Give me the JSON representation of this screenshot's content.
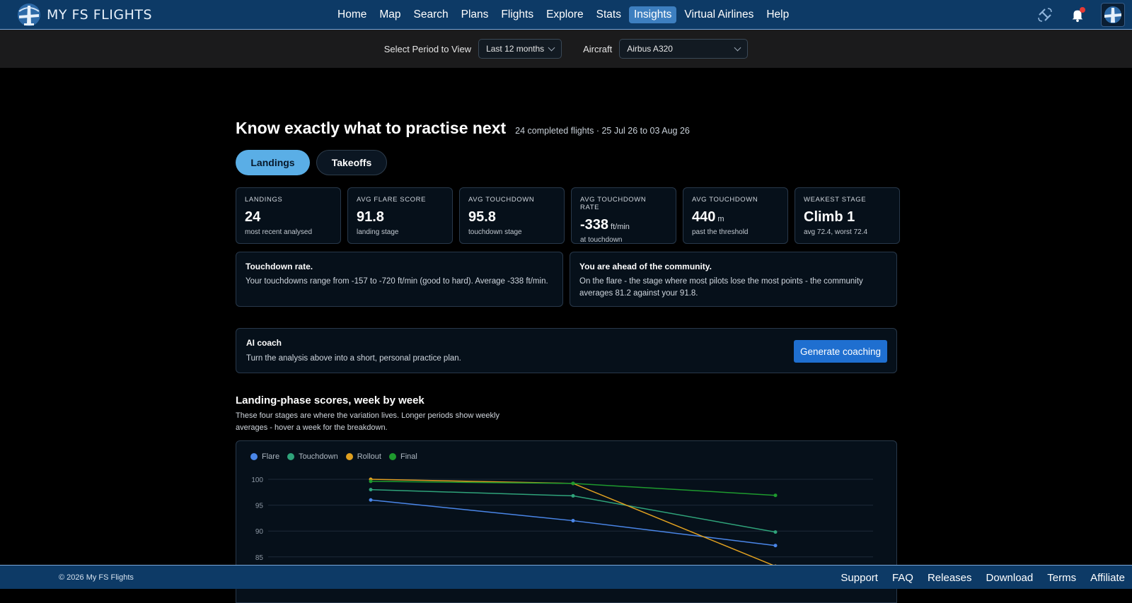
{
  "brand": {
    "name": "MY FS FLIGHTS"
  },
  "nav": {
    "items": [
      "Home",
      "Map",
      "Search",
      "Plans",
      "Flights",
      "Explore",
      "Stats",
      "Insights",
      "Virtual Airlines",
      "Help"
    ],
    "active": "Insights"
  },
  "icons": {
    "nav_right": [
      "satellite-icon",
      "bell-icon",
      "avatar"
    ],
    "accent": "#5aaee6",
    "nav_bg": "#0d3a66",
    "button_blue": "#1f6fd0"
  },
  "filters": {
    "period_label": "Select Period to View",
    "period_value": "Last 12 months",
    "aircraft_label": "Aircraft",
    "aircraft_value": "Airbus A320"
  },
  "header": {
    "title": "Know exactly what to practise next",
    "subtitle": "24 completed flights · 25 Jul 26 to 03 Aug 26"
  },
  "tabs": [
    {
      "label": "Landings",
      "active": true
    },
    {
      "label": "Takeoffs",
      "active": false
    }
  ],
  "stats": [
    {
      "label": "Landings",
      "value": "24",
      "unit": "",
      "sub": "most recent analysed"
    },
    {
      "label": "Avg flare score",
      "value": "91.8",
      "unit": "",
      "sub": "landing stage"
    },
    {
      "label": "Avg touchdown",
      "value": "95.8",
      "unit": "",
      "sub": "touchdown stage"
    },
    {
      "label": "Avg touchdown rate",
      "value": "-338",
      "unit": "ft/min",
      "sub": "at touchdown"
    },
    {
      "label": "Avg touchdown",
      "value": "440",
      "unit": "m",
      "sub": "past the threshold"
    },
    {
      "label": "Weakest stage",
      "value": "Climb 1",
      "unit": "",
      "sub": "avg 72.4, worst 72.4"
    }
  ],
  "insights": [
    {
      "title": "Touchdown rate.",
      "text": "Your touchdowns range from -157 to -720 ft/min (good to hard). Average -338 ft/min."
    },
    {
      "title": "You are ahead of the community.",
      "text": "On the flare - the stage where most pilots lose the most points - the community averages 81.2 against your 91.8."
    }
  ],
  "coach": {
    "title": "AI coach",
    "text": "Turn the analysis above into a short, personal practice plan.",
    "button": "Generate coaching"
  },
  "section": {
    "title": "Landing-phase scores, week by week",
    "description": "These four stages are where the variation lives. Longer periods show weekly averages - hover a week for the breakdown."
  },
  "chart_data": {
    "type": "line",
    "title": "",
    "x": [
      1,
      2,
      3
    ],
    "yticks": [
      100,
      95,
      90,
      85
    ],
    "ylim": [
      80.5,
      100
    ],
    "grid": true,
    "legend_position": "top-left",
    "series": [
      {
        "name": "Flare",
        "color": "#4a86e8",
        "values": [
          96.0,
          92.0,
          87.2
        ]
      },
      {
        "name": "Touchdown",
        "color": "#2fa37a",
        "values": [
          98.0,
          96.8,
          89.8
        ]
      },
      {
        "name": "Rollout",
        "color": "#e0a020",
        "values": [
          100.0,
          99.2,
          83.2
        ]
      },
      {
        "name": "Final",
        "color": "#1e9a2e",
        "values": [
          99.6,
          99.2,
          96.9
        ]
      }
    ]
  },
  "footer": {
    "copyright": "© 2026 My FS Flights",
    "links": [
      "Support",
      "FAQ",
      "Releases",
      "Download",
      "Terms",
      "Affiliate"
    ]
  }
}
